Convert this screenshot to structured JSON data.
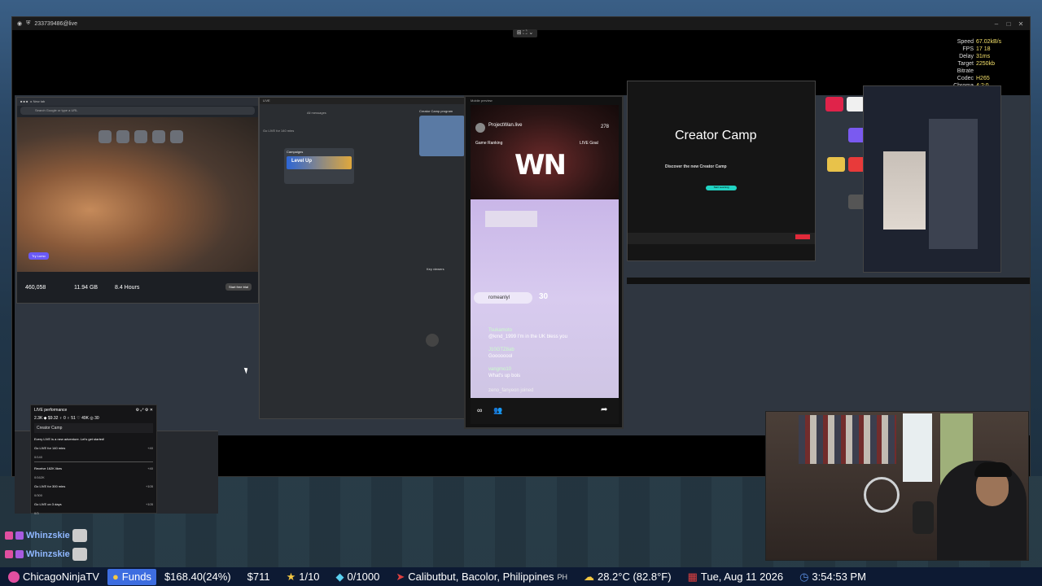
{
  "remote": {
    "title": "233739486@live",
    "controls": [
      "–",
      "□",
      "✕"
    ],
    "view_control": "⊞ ⛶ ⌄"
  },
  "stream_stats": [
    {
      "k": "Speed",
      "v": "67.02kB/s"
    },
    {
      "k": "FPS",
      "v": "17 18"
    },
    {
      "k": "Delay",
      "v": "31ms"
    },
    {
      "k": "Target Bitrate",
      "v": "2250kb"
    },
    {
      "k": "Codec",
      "v": "H265"
    },
    {
      "k": "Chroma",
      "v": "4:2:0"
    }
  ],
  "browser": {
    "address": "Search Google or type a URL",
    "footer_stat1": "460,058",
    "footer_stat2": "11.94 GB",
    "footer_stat3": "8.4 Hours",
    "try_button": "Try Lumo",
    "start_button": "Start free trial"
  },
  "studio": {
    "tab": "All messages",
    "live_label": "Go LIVE for 140 mins",
    "campaigns": "Campaigns",
    "level_up": "Level Up",
    "promo_title": "Creator Camp program",
    "key_viewers": "Key viewers"
  },
  "phone": {
    "header": "Mobile preview",
    "username": "ProjectWan.live",
    "viewers": "278",
    "game_ranking": "Game Ranking",
    "live_goal": "LIVE Goal",
    "logo": "WN",
    "comment1_user": "romeanlyl",
    "gift_count": "30",
    "comment2_user": "Tsukamoto",
    "comment2_text": "@kmd_1999 I'm in the UK bless you",
    "comment3_user": "J10GTZ8ab",
    "comment3_text": "Goooooool",
    "comment4_user": "vangmo10",
    "comment4_text": "What's up bois",
    "joined": "zeno_fanyeon  joined"
  },
  "obs": {
    "logo": "Creator Camp",
    "subtitle": "Discover the new Creator Camp",
    "button": "Start Learning"
  },
  "live_performance": {
    "title": "LIVE performance",
    "stats": "2.3K  ◆ $9.32  ♀ 0  ♀ 51  ♡ 49K  ◎ 30",
    "tab": "Creator Camp",
    "headline": "Every LIVE is a new adventure. Let's get started!",
    "tasks": [
      {
        "name": "Go LIVE for 140 mins",
        "progress": "0/140",
        "reward": "+40"
      },
      {
        "name": "Receive 162K likes",
        "progress": "0/162K",
        "reward": "+40"
      },
      {
        "name": "Go LIVE for 300 mins",
        "progress": "0/300",
        "reward": "+105"
      },
      {
        "name": "Go LIVE on 3 days",
        "progress": "0/3",
        "reward": "+105"
      }
    ]
  },
  "chat": [
    {
      "user": "Whinzskie"
    },
    {
      "user": "Whinzskie"
    }
  ],
  "ticker": {
    "channel": "ChicagoNinjaTV",
    "funds_label": "Funds",
    "funds_value": "$168.40(24%)",
    "amount2": "$711",
    "stars": "1/10",
    "gems": "0/1000",
    "location": "Calibutbut, Bacolor, Philippines",
    "country": "PH",
    "weather": "28.2°C (82.8°F)",
    "date": "Tue, Aug 11 2026",
    "time": "3:54:53 PM"
  }
}
